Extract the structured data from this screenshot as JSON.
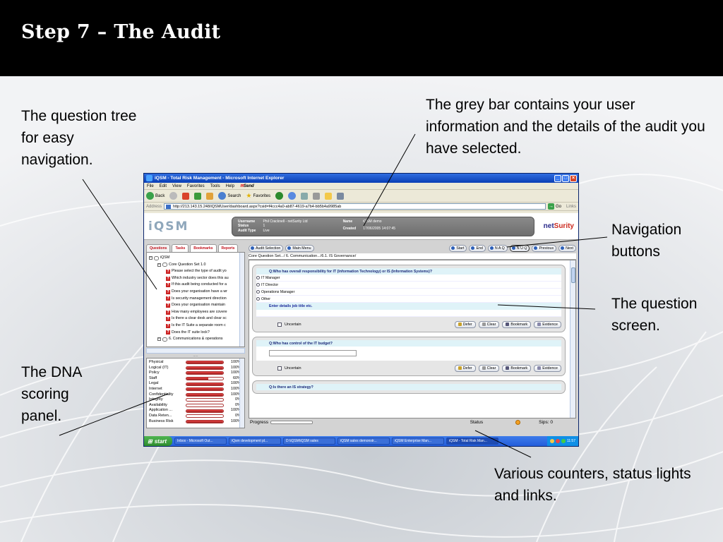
{
  "slide": {
    "title": "Step 7 – The Audit",
    "annotations": {
      "tree": "The question tree for easy navigation.",
      "grey_bar": "The grey bar contains your user information and the details of the audit you have selected.",
      "nav": "Navigation buttons",
      "question": "The question screen.",
      "dna": "The DNA scoring panel.",
      "counters": "Various counters, status lights and links."
    }
  },
  "browser": {
    "title": "iQSM - Total Risk Management - Microsoft Internet Explorer",
    "menu": [
      "File",
      "Edit",
      "View",
      "Favorites",
      "Tools",
      "Help"
    ],
    "send": "Send",
    "toolbar": {
      "back": "Back",
      "search": "Search",
      "favorites": "Favorites"
    },
    "address_label": "Address",
    "address": "http://213.143.15.248/iQSMUser/dashboard.aspx?csid=f4ccc4a0-ab87-4619-a7b4-bb5b4a9985ab",
    "go": "Go",
    "links": "Links"
  },
  "app": {
    "logo": "iQSM",
    "brand_a": "net",
    "brand_b": "Surity",
    "info": {
      "labels_left": [
        "Username",
        "Status",
        "Audit Type"
      ],
      "values_left": [
        "Phil Cracknell - netSurity Ltd",
        "1",
        "Live"
      ],
      "labels_right": [
        "Name",
        "Created"
      ],
      "values_right": [
        "iQSM demo",
        "17/06/2005 14:07:45"
      ]
    },
    "tabs": [
      "Questions",
      "Tasks",
      "Bookmarks",
      "Reports"
    ],
    "tree": [
      {
        "kind": "root",
        "text": "iQSM"
      },
      {
        "kind": "set",
        "text": "Core Question Set 1.0"
      },
      {
        "kind": "q",
        "text": "Please select the type of audit yo"
      },
      {
        "kind": "q",
        "text": "Which industry sector does this au"
      },
      {
        "kind": "q",
        "text": "If this audit being conducted for a"
      },
      {
        "kind": "q",
        "text": "Does your organisation have a wr"
      },
      {
        "kind": "q",
        "text": "Is security management direction"
      },
      {
        "kind": "q",
        "text": "Does your organisation maintain"
      },
      {
        "kind": "q",
        "text": "How many employees are covere"
      },
      {
        "kind": "q",
        "text": "Is there a clear desk and clear sc"
      },
      {
        "kind": "q",
        "text": "Is the IT Suite a separate room c"
      },
      {
        "kind": "q",
        "text": "Does the IT suite lock?"
      },
      {
        "kind": "set",
        "text": "6. Communications & operations"
      }
    ],
    "dna": [
      {
        "label": "Physical",
        "pct": "100%",
        "fill": 1.0
      },
      {
        "label": "Logical (IT)",
        "pct": "100%",
        "fill": 1.0
      },
      {
        "label": "Policy",
        "pct": "100%",
        "fill": 1.0
      },
      {
        "label": "Staff",
        "pct": "60%",
        "fill": 0.6
      },
      {
        "label": "Legal",
        "pct": "100%",
        "fill": 1.0
      },
      {
        "label": "Internet",
        "pct": "100%",
        "fill": 1.0
      },
      {
        "label": "Confidentiality",
        "pct": "100%",
        "fill": 1.0
      },
      {
        "label": "Integrity",
        "pct": "0%",
        "fill": 0.0
      },
      {
        "label": "Availability",
        "pct": "0%",
        "fill": 0.0
      },
      {
        "label": "Application ...",
        "pct": "100%",
        "fill": 1.0
      },
      {
        "label": "Data Reten...",
        "pct": "0%",
        "fill": 0.0
      },
      {
        "label": "Business Risk",
        "pct": "100%",
        "fill": 1.0
      }
    ],
    "nav": {
      "audit_selection": "Audit Selection",
      "main_menu": "Main Menu",
      "start": "Start",
      "end": "End",
      "naq": "N A Q",
      "nuq": "N U Q",
      "previous": "Previous",
      "next": "Next"
    },
    "breadcrumb": "Core Question Set.../ 6. Communication.../6.1. IS Governance/",
    "questions": [
      {
        "text": "Q:Who has overall responsibility for IT (Information Technology) or IS (Information Systems)?",
        "options": [
          "IT Manager",
          "IT Director",
          "Operations Manager",
          "Other"
        ],
        "hint": "Enter details job title etc."
      },
      {
        "text": "Q:Who has control of the IT budget?"
      },
      {
        "text": "Q:Is there an IS strategy?"
      }
    ],
    "question_buttons": {
      "uncertain": "Uncertain",
      "defer": "Defer",
      "clear": "Clear",
      "bookmark": "Bookmark",
      "evidence": "Evidence"
    },
    "status": {
      "progress": "Progress",
      "status": "Status",
      "sips": "Sips: 0"
    }
  },
  "taskbar": {
    "start": "start",
    "tasks": [
      "Inbox - Microsoft Out...",
      "iQsm development pl...",
      "D:\\iQSM\\iQSM sales",
      "iQSM sales demonstr...",
      "iQSM Enterprise Man...",
      "iQSM - Total Risk Man..."
    ],
    "clock": "11:57"
  },
  "colors": {
    "title_bar": "#000000",
    "ie_blue": "#0b3fb5",
    "red_accent": "#c2111b",
    "dna_bar": "#cc2a2a"
  }
}
